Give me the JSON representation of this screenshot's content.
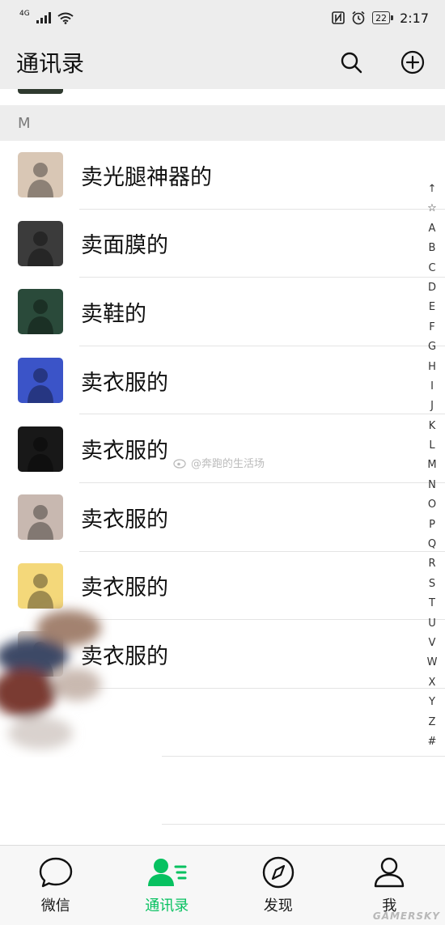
{
  "status_bar": {
    "network": "4G",
    "battery": "22",
    "time": "2:17"
  },
  "nav": {
    "title": "通讯录",
    "icons": [
      "search-icon",
      "add-circle-icon"
    ]
  },
  "section": {
    "letter": "M"
  },
  "contacts": [
    {
      "name": "卖光腿神器的",
      "avatar_color": "#d9c7b5"
    },
    {
      "name": "卖面膜的",
      "avatar_color": "#3b3b3b"
    },
    {
      "name": "卖鞋的",
      "avatar_color": "#2a4a3a"
    },
    {
      "name": "卖衣服的",
      "avatar_color": "#3b54c8"
    },
    {
      "name": "卖衣服的",
      "avatar_color": "#181818"
    },
    {
      "name": "卖衣服的",
      "avatar_color": "#c8b8b0"
    },
    {
      "name": "卖衣服的",
      "avatar_color": "#f4d87a"
    },
    {
      "name": "卖衣服的",
      "avatar_color": "#cfc6bf"
    }
  ],
  "index_letters": [
    "↑",
    "☆",
    "A",
    "B",
    "C",
    "D",
    "E",
    "F",
    "G",
    "H",
    "I",
    "J",
    "K",
    "L",
    "M",
    "N",
    "O",
    "P",
    "Q",
    "R",
    "S",
    "T",
    "U",
    "V",
    "W",
    "X",
    "Y",
    "Z",
    "#"
  ],
  "watermark": "@奔跑的生活场",
  "tabs": [
    {
      "label": "微信",
      "icon": "chat-icon"
    },
    {
      "label": "通讯录",
      "icon": "contacts-icon",
      "active": true
    },
    {
      "label": "发现",
      "icon": "compass-icon"
    },
    {
      "label": "我",
      "icon": "profile-icon"
    }
  ],
  "corner_watermark": "GAMERSKY",
  "colors": {
    "accent": "#07c160",
    "header_bg": "#ededed"
  }
}
